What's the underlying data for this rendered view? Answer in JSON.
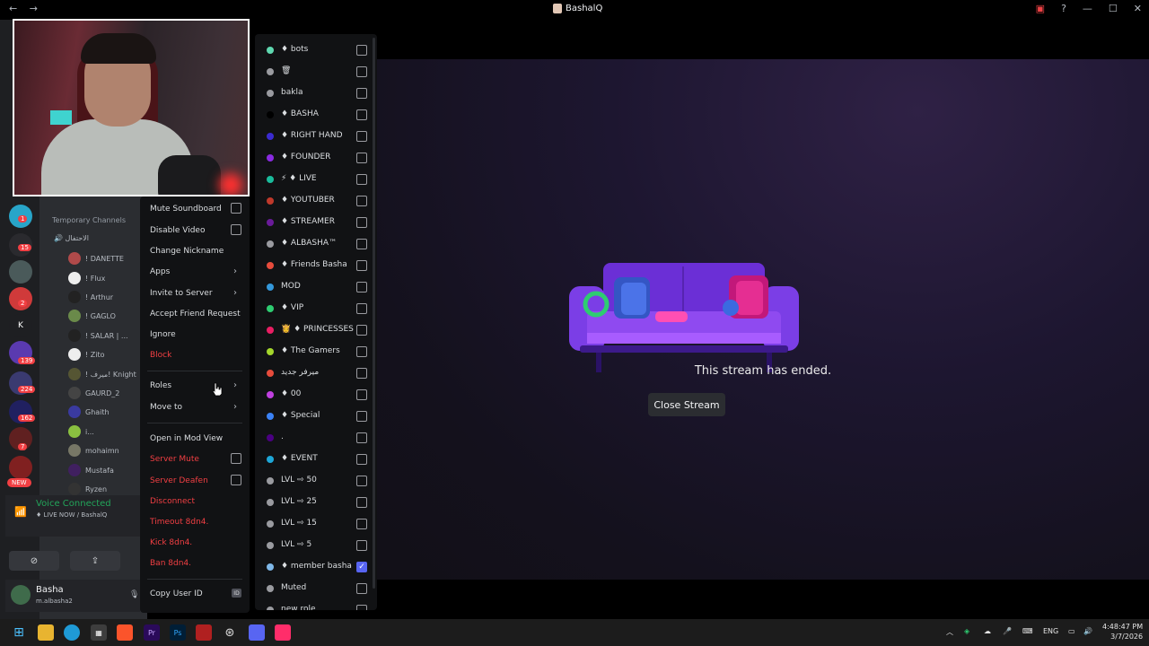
{
  "titlebar": {
    "title": "BashalQ",
    "back": "←",
    "forward": "→",
    "monitor_icon": "screen-share-icon",
    "help": "?",
    "minimize": "—",
    "maximize": "☐",
    "close": "✕"
  },
  "stream": {
    "ended_text": "This stream has ended.",
    "close_button": "Close Stream"
  },
  "servers": {
    "badges": [
      "1",
      "15",
      "2",
      "139",
      "224",
      "162",
      "7"
    ],
    "letter_k": "K",
    "new_label": "NEW"
  },
  "channels": {
    "category": "Temporary Channels",
    "voice_channel": "الاحتفال",
    "members": [
      "! DANETTE",
      "! Flux",
      "! Arthur",
      "! GAGLO",
      "! SALAR | ...",
      "! Zito",
      "! ميرف! Knight",
      "GAURD_2",
      "Ghaith",
      "i...",
      "mohaimn",
      "Mustafa",
      "Ryzen"
    ]
  },
  "voice": {
    "status": "Voice Connected",
    "sub": "♦ LIVE NOW / BashalQ"
  },
  "user": {
    "name": "Basha",
    "status": "m.albasha2"
  },
  "context_menu": {
    "mute_soundboard": "Mute Soundboard",
    "disable_video": "Disable Video",
    "change_nickname": "Change Nickname",
    "apps": "Apps",
    "invite": "Invite to Server",
    "accept_friend": "Accept Friend Request",
    "ignore": "Ignore",
    "block": "Block",
    "roles": "Roles",
    "move_to": "Move to",
    "mod_view": "Open in Mod View",
    "server_mute": "Server Mute",
    "server_deafen": "Server Deafen",
    "disconnect": "Disconnect",
    "timeout": "Timeout 8dn4.",
    "kick": "Kick 8dn4.",
    "ban": "Ban 8dn4.",
    "copy_id": "Copy User ID",
    "id_badge": "ID"
  },
  "roles": [
    {
      "name": "♦ bots",
      "color": "#5fd8b0",
      "checked": false
    },
    {
      "name": "🗑",
      "color": "#9a9ba0",
      "checked": false
    },
    {
      "name": "bakla",
      "color": "#9a9ba0",
      "checked": false
    },
    {
      "name": "♦ BASHA",
      "color": "#000000",
      "checked": false
    },
    {
      "name": "♦ RIGHT HAND",
      "color": "#3b2bd0",
      "checked": false
    },
    {
      "name": "♦ FOUNDER",
      "color": "#8a2be2",
      "checked": false
    },
    {
      "name": "⚡ ♦ LIVE",
      "color": "#1abc9c",
      "checked": false
    },
    {
      "name": "♦ YOUTUBER",
      "color": "#c0392b",
      "checked": false
    },
    {
      "name": "♦ STREAMER",
      "color": "#6a1b9a",
      "checked": false
    },
    {
      "name": "♦ ALBASHA™",
      "color": "#9a9ba0",
      "checked": false
    },
    {
      "name": "♦ Friends Basha",
      "color": "#e74c3c",
      "checked": false
    },
    {
      "name": "MOD",
      "color": "#3498db",
      "checked": false
    },
    {
      "name": "♦ VIP",
      "color": "#2ecc71",
      "checked": false
    },
    {
      "name": "👸 ♦ PRINCESSES",
      "color": "#e91e63",
      "checked": false
    },
    {
      "name": "♦ The Gamers",
      "color": "#a4d62c",
      "checked": false
    },
    {
      "name": "ميرفر جديد",
      "color": "#e74c3c",
      "checked": false
    },
    {
      "name": "♦ 00",
      "color": "#c040e0",
      "checked": false
    },
    {
      "name": "♦ Special",
      "color": "#3b82f6",
      "checked": false
    },
    {
      "name": ".",
      "color": "#4b0082",
      "checked": false
    },
    {
      "name": "♦ EVENT",
      "color": "#1ea7d8",
      "checked": false
    },
    {
      "name": "LVL ⇨ 50",
      "color": "#9a9ba0",
      "checked": false
    },
    {
      "name": "LVL ⇨ 25",
      "color": "#9a9ba0",
      "checked": false
    },
    {
      "name": "LVL ⇨ 15",
      "color": "#9a9ba0",
      "checked": false
    },
    {
      "name": "LVL ⇨ 5",
      "color": "#9a9ba0",
      "checked": false
    },
    {
      "name": "♦ member basha",
      "color": "#7fb8e8",
      "checked": true
    },
    {
      "name": "Muted",
      "color": "#9a9ba0",
      "checked": false
    },
    {
      "name": "new role",
      "color": "#9a9ba0",
      "checked": false
    }
  ],
  "taskbar": {
    "lang": "ENG",
    "time": "4:48:47 PM",
    "date": "3/7/2026",
    "icons": [
      "windows-start-icon",
      "file-explorer-icon",
      "edge-icon",
      "store-icon",
      "brave-icon",
      "premiere-icon",
      "photoshop-icon",
      "snipping-icon",
      "steam-icon",
      "discord-icon",
      "tiktok-icon"
    ],
    "premiere": "Pr",
    "photoshop": "Ps"
  }
}
